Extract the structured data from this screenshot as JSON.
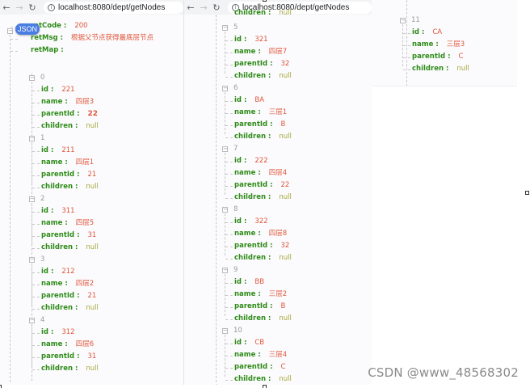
{
  "browser": {
    "url_left": "localhost:8080/dept/getNodes",
    "url_mid": "localhost:8080/dept/getNodes"
  },
  "viewer": {
    "badge": "JSON"
  },
  "json": {
    "keys": {
      "retCode": "retCode :",
      "retMsg": "retMsg :",
      "retMap": "retMap :",
      "id": "id :",
      "name": "name :",
      "parentId": "parentId :",
      "children": "children :"
    },
    "retCode": "200",
    "retMsg": "根据父节点获得最底层节点",
    "items": [
      {
        "index": "0",
        "id": "221",
        "name": "四层3",
        "parentId": "22",
        "children": "null"
      },
      {
        "index": "1",
        "id": "211",
        "name": "四层1",
        "parentId": "21",
        "children": "null"
      },
      {
        "index": "2",
        "id": "311",
        "name": "四层5",
        "parentId": "31",
        "children": "null"
      },
      {
        "index": "3",
        "id": "212",
        "name": "四层2",
        "parentId": "21",
        "children": "null"
      },
      {
        "index": "4",
        "id": "312",
        "name": "四层6",
        "parentId": "31",
        "children": "null"
      },
      {
        "index": "5",
        "id": "321",
        "name": "四层7",
        "parentId": "32",
        "children": "null"
      },
      {
        "index": "6",
        "id": "BA",
        "name": "三层1",
        "parentId": "B",
        "children": "null"
      },
      {
        "index": "7",
        "id": "222",
        "name": "四层4",
        "parentId": "22",
        "children": "null"
      },
      {
        "index": "8",
        "id": "322",
        "name": "四层8",
        "parentId": "32",
        "children": "null"
      },
      {
        "index": "9",
        "id": "BB",
        "name": "三层2",
        "parentId": "B",
        "children": "null"
      },
      {
        "index": "10",
        "id": "CB",
        "name": "三层4",
        "parentId": "C",
        "children": "null"
      },
      {
        "index": "11",
        "id": "CA",
        "name": "三层3",
        "parentId": "C",
        "children": "null"
      }
    ]
  },
  "watermark": "CSDN @www_48568302"
}
